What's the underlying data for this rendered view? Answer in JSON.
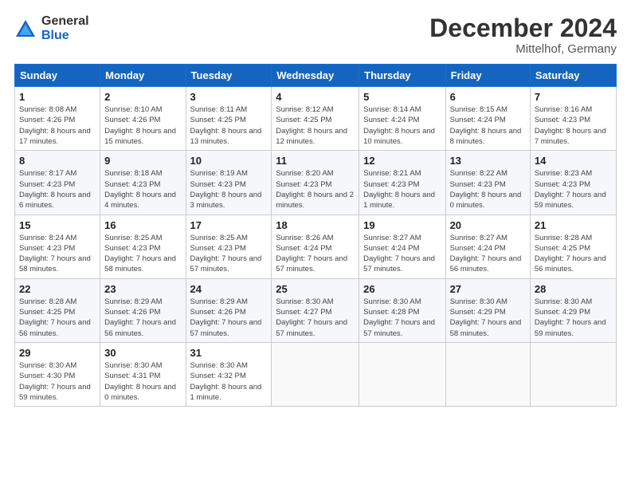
{
  "logo": {
    "general": "General",
    "blue": "Blue"
  },
  "header": {
    "month": "December 2024",
    "location": "Mittelhof, Germany"
  },
  "weekdays": [
    "Sunday",
    "Monday",
    "Tuesday",
    "Wednesday",
    "Thursday",
    "Friday",
    "Saturday"
  ],
  "weeks": [
    [
      {
        "day": "1",
        "sunrise": "Sunrise: 8:08 AM",
        "sunset": "Sunset: 4:26 PM",
        "daylight": "Daylight: 8 hours and 17 minutes."
      },
      {
        "day": "2",
        "sunrise": "Sunrise: 8:10 AM",
        "sunset": "Sunset: 4:26 PM",
        "daylight": "Daylight: 8 hours and 15 minutes."
      },
      {
        "day": "3",
        "sunrise": "Sunrise: 8:11 AM",
        "sunset": "Sunset: 4:25 PM",
        "daylight": "Daylight: 8 hours and 13 minutes."
      },
      {
        "day": "4",
        "sunrise": "Sunrise: 8:12 AM",
        "sunset": "Sunset: 4:25 PM",
        "daylight": "Daylight: 8 hours and 12 minutes."
      },
      {
        "day": "5",
        "sunrise": "Sunrise: 8:14 AM",
        "sunset": "Sunset: 4:24 PM",
        "daylight": "Daylight: 8 hours and 10 minutes."
      },
      {
        "day": "6",
        "sunrise": "Sunrise: 8:15 AM",
        "sunset": "Sunset: 4:24 PM",
        "daylight": "Daylight: 8 hours and 8 minutes."
      },
      {
        "day": "7",
        "sunrise": "Sunrise: 8:16 AM",
        "sunset": "Sunset: 4:23 PM",
        "daylight": "Daylight: 8 hours and 7 minutes."
      }
    ],
    [
      {
        "day": "8",
        "sunrise": "Sunrise: 8:17 AM",
        "sunset": "Sunset: 4:23 PM",
        "daylight": "Daylight: 8 hours and 6 minutes."
      },
      {
        "day": "9",
        "sunrise": "Sunrise: 8:18 AM",
        "sunset": "Sunset: 4:23 PM",
        "daylight": "Daylight: 8 hours and 4 minutes."
      },
      {
        "day": "10",
        "sunrise": "Sunrise: 8:19 AM",
        "sunset": "Sunset: 4:23 PM",
        "daylight": "Daylight: 8 hours and 3 minutes."
      },
      {
        "day": "11",
        "sunrise": "Sunrise: 8:20 AM",
        "sunset": "Sunset: 4:23 PM",
        "daylight": "Daylight: 8 hours and 2 minutes."
      },
      {
        "day": "12",
        "sunrise": "Sunrise: 8:21 AM",
        "sunset": "Sunset: 4:23 PM",
        "daylight": "Daylight: 8 hours and 1 minute."
      },
      {
        "day": "13",
        "sunrise": "Sunrise: 8:22 AM",
        "sunset": "Sunset: 4:23 PM",
        "daylight": "Daylight: 8 hours and 0 minutes."
      },
      {
        "day": "14",
        "sunrise": "Sunrise: 8:23 AM",
        "sunset": "Sunset: 4:23 PM",
        "daylight": "Daylight: 7 hours and 59 minutes."
      }
    ],
    [
      {
        "day": "15",
        "sunrise": "Sunrise: 8:24 AM",
        "sunset": "Sunset: 4:23 PM",
        "daylight": "Daylight: 7 hours and 58 minutes."
      },
      {
        "day": "16",
        "sunrise": "Sunrise: 8:25 AM",
        "sunset": "Sunset: 4:23 PM",
        "daylight": "Daylight: 7 hours and 58 minutes."
      },
      {
        "day": "17",
        "sunrise": "Sunrise: 8:25 AM",
        "sunset": "Sunset: 4:23 PM",
        "daylight": "Daylight: 7 hours and 57 minutes."
      },
      {
        "day": "18",
        "sunrise": "Sunrise: 8:26 AM",
        "sunset": "Sunset: 4:24 PM",
        "daylight": "Daylight: 7 hours and 57 minutes."
      },
      {
        "day": "19",
        "sunrise": "Sunrise: 8:27 AM",
        "sunset": "Sunset: 4:24 PM",
        "daylight": "Daylight: 7 hours and 57 minutes."
      },
      {
        "day": "20",
        "sunrise": "Sunrise: 8:27 AM",
        "sunset": "Sunset: 4:24 PM",
        "daylight": "Daylight: 7 hours and 56 minutes."
      },
      {
        "day": "21",
        "sunrise": "Sunrise: 8:28 AM",
        "sunset": "Sunset: 4:25 PM",
        "daylight": "Daylight: 7 hours and 56 minutes."
      }
    ],
    [
      {
        "day": "22",
        "sunrise": "Sunrise: 8:28 AM",
        "sunset": "Sunset: 4:25 PM",
        "daylight": "Daylight: 7 hours and 56 minutes."
      },
      {
        "day": "23",
        "sunrise": "Sunrise: 8:29 AM",
        "sunset": "Sunset: 4:26 PM",
        "daylight": "Daylight: 7 hours and 56 minutes."
      },
      {
        "day": "24",
        "sunrise": "Sunrise: 8:29 AM",
        "sunset": "Sunset: 4:26 PM",
        "daylight": "Daylight: 7 hours and 57 minutes."
      },
      {
        "day": "25",
        "sunrise": "Sunrise: 8:30 AM",
        "sunset": "Sunset: 4:27 PM",
        "daylight": "Daylight: 7 hours and 57 minutes."
      },
      {
        "day": "26",
        "sunrise": "Sunrise: 8:30 AM",
        "sunset": "Sunset: 4:28 PM",
        "daylight": "Daylight: 7 hours and 57 minutes."
      },
      {
        "day": "27",
        "sunrise": "Sunrise: 8:30 AM",
        "sunset": "Sunset: 4:29 PM",
        "daylight": "Daylight: 7 hours and 58 minutes."
      },
      {
        "day": "28",
        "sunrise": "Sunrise: 8:30 AM",
        "sunset": "Sunset: 4:29 PM",
        "daylight": "Daylight: 7 hours and 59 minutes."
      }
    ],
    [
      {
        "day": "29",
        "sunrise": "Sunrise: 8:30 AM",
        "sunset": "Sunset: 4:30 PM",
        "daylight": "Daylight: 7 hours and 59 minutes."
      },
      {
        "day": "30",
        "sunrise": "Sunrise: 8:30 AM",
        "sunset": "Sunset: 4:31 PM",
        "daylight": "Daylight: 8 hours and 0 minutes."
      },
      {
        "day": "31",
        "sunrise": "Sunrise: 8:30 AM",
        "sunset": "Sunset: 4:32 PM",
        "daylight": "Daylight: 8 hours and 1 minute."
      },
      null,
      null,
      null,
      null
    ]
  ]
}
